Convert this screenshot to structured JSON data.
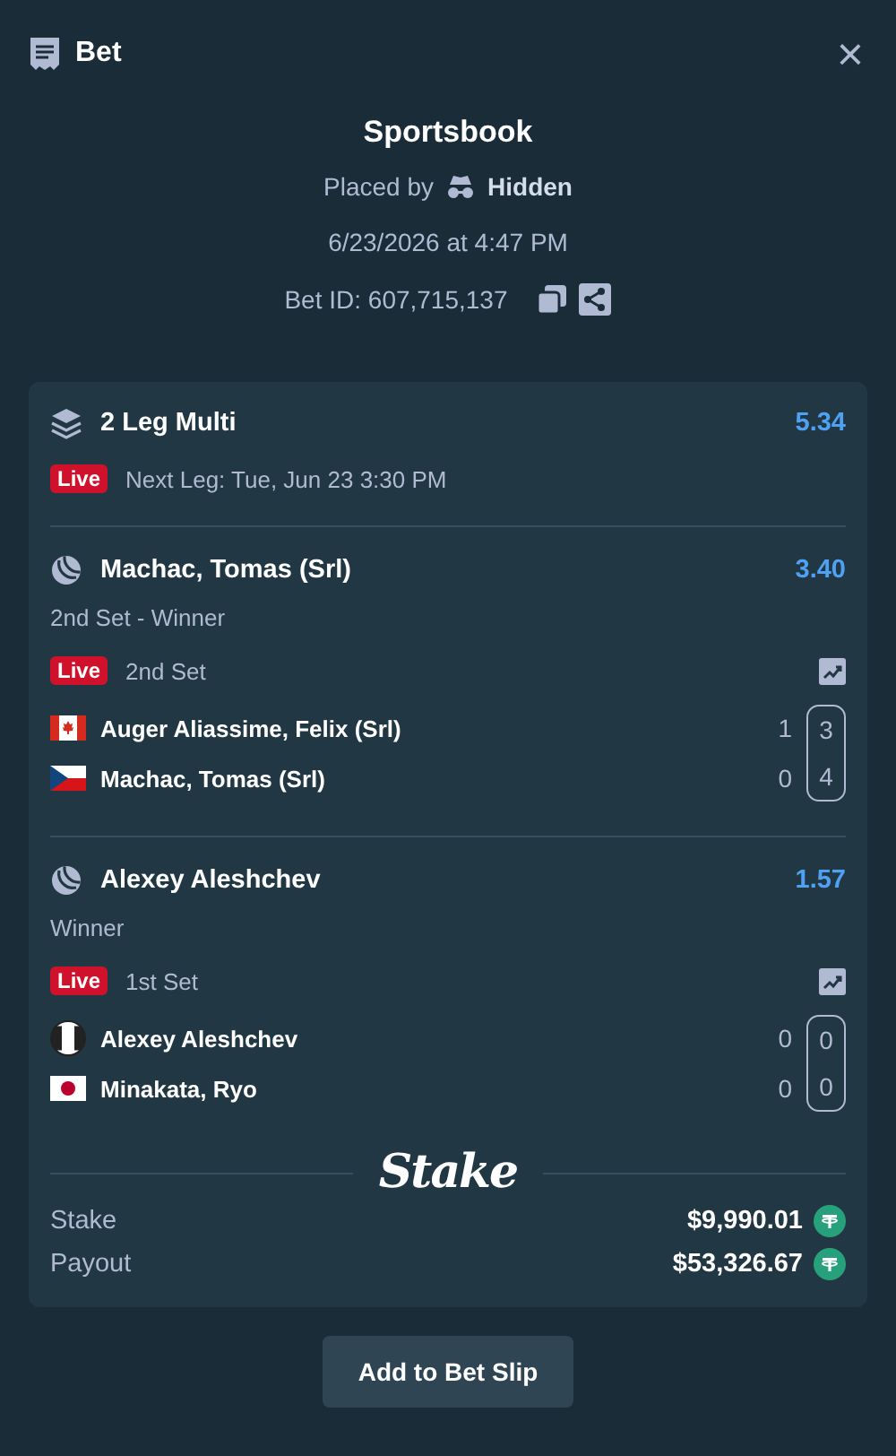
{
  "header": {
    "title": "Bet",
    "close": "×"
  },
  "summary": {
    "title": "Sportsbook",
    "placed_by": "Placed by",
    "user": "Hidden",
    "date": "6/23/2026 at 4:47 PM",
    "bet_id": "Bet ID: 607,715,137"
  },
  "multi": {
    "title": "2 Leg Multi",
    "odds": "5.34",
    "badge": "Live",
    "next_leg": "Next Leg: Tue, Jun 23 3:30 PM"
  },
  "legs": [
    {
      "selection": "Machac, Tomas (Srl)",
      "odds": "3.40",
      "market": "2nd Set - Winner",
      "badge": "Live",
      "period": "2nd Set",
      "players": [
        {
          "name": "Auger Aliassime, Felix (Srl)",
          "scores": [
            "1",
            "3"
          ]
        },
        {
          "name": "Machac, Tomas (Srl)",
          "scores": [
            "0",
            "4"
          ]
        }
      ]
    },
    {
      "selection": "Alexey Aleshchev",
      "odds": "1.57",
      "market": "Winner",
      "badge": "Live",
      "period": "1st Set",
      "players": [
        {
          "name": "Alexey Aleshchev",
          "scores": [
            "0",
            "0"
          ]
        },
        {
          "name": "Minakata, Ryo",
          "scores": [
            "0",
            "0"
          ]
        }
      ]
    }
  ],
  "brand": "Stake",
  "totals": [
    {
      "label": "Stake",
      "amount": "$9,990.01"
    },
    {
      "label": "Payout",
      "amount": "$53,326.67"
    }
  ],
  "button": "Add to Bet Slip"
}
